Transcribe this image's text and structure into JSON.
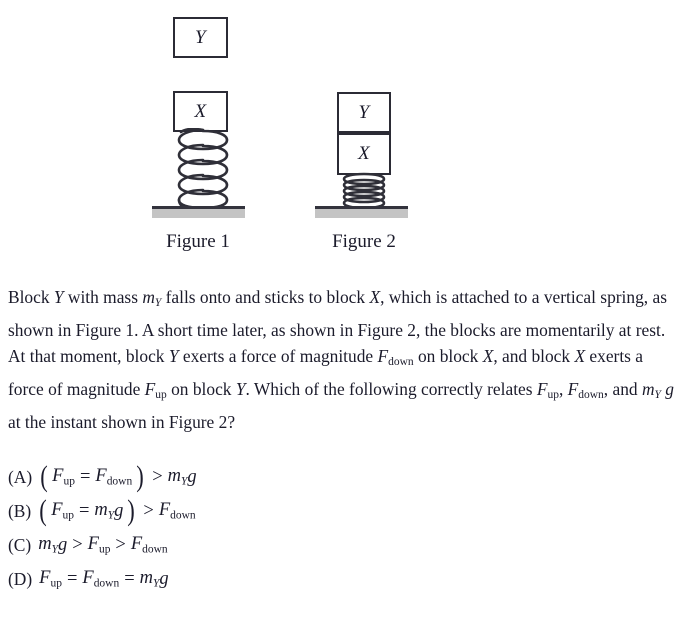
{
  "figures": [
    {
      "id": "figure-1",
      "caption": "Figure 1",
      "blocks": [
        {
          "label": "Y",
          "name": "block-y-falling"
        },
        {
          "label": "X",
          "name": "block-x-on-spring"
        }
      ],
      "spring_state": "extended",
      "spring_coils": 5
    },
    {
      "id": "figure-2",
      "caption": "Figure 2",
      "blocks": [
        {
          "label": "Y",
          "name": "block-y-stacked"
        },
        {
          "label": "X",
          "name": "block-x-stacked"
        }
      ],
      "spring_state": "compressed",
      "spring_coils": 5
    }
  ],
  "question": {
    "line1_a": "Block ",
    "line1_b": "Y",
    "line1_c": " with mass ",
    "line1_m": "m",
    "line1_sub": "Y",
    "line1_d": " falls onto and sticks to block ",
    "line1_e": "X",
    "line1_f": ", which is attached to a",
    "line2_a": "vertical spring, as shown in Figure 1. A short time later, as shown in Figure 2,",
    "line3_a": "the blocks are momentarily at rest. At that moment, block ",
    "line3_b": "Y",
    "line3_c": " exerts a force of",
    "line4_a": "magnitude ",
    "line4_F": "F",
    "line4_sub": "down",
    "line4_b": " on block ",
    "line4_c": "X",
    "line4_d": ", and block ",
    "line4_e": "X",
    "line4_f": " exerts a force of magnitude ",
    "line4_F2": "F",
    "line4_sub2": "up",
    "line4_g": " on",
    "line5_a": "block ",
    "line5_b": "Y",
    "line5_c": ". Which of the following correctly relates ",
    "line5_F1": "F",
    "line5_sub1": "up",
    "line5_comma1": ", ",
    "line5_F2": "F",
    "line5_sub2": "down",
    "line5_comma2": ", and ",
    "line5_m": "m",
    "line5_msub": "Y",
    "line5_g": " g",
    "line5_d": " at the instant",
    "line6_a": "shown in Figure 2?"
  },
  "choices": [
    {
      "tag": "(A)",
      "name": "choice-a",
      "paren": true,
      "inner": [
        {
          "sym": "F",
          "sub": "up",
          "sub_italic": false
        },
        {
          "op": "="
        },
        {
          "sym": "F",
          "sub": "down",
          "sub_italic": false
        }
      ],
      "after": [
        {
          "op": ">"
        },
        {
          "sym": "m",
          "sub": "Y",
          "sub_italic": true
        },
        {
          "sym": "g",
          "sub": ""
        }
      ]
    },
    {
      "tag": "(B)",
      "name": "choice-b",
      "paren": true,
      "inner": [
        {
          "sym": "F",
          "sub": "up",
          "sub_italic": false
        },
        {
          "op": "="
        },
        {
          "sym": "m",
          "sub": "Y",
          "sub_italic": true
        },
        {
          "sym": "g",
          "sub": ""
        }
      ],
      "after": [
        {
          "op": ">"
        },
        {
          "sym": "F",
          "sub": "down",
          "sub_italic": false
        }
      ]
    },
    {
      "tag": "(C)",
      "name": "choice-c",
      "paren": false,
      "inner": [],
      "after": [
        {
          "sym": "m",
          "sub": "Y",
          "sub_italic": true
        },
        {
          "sym": "g",
          "sub": ""
        },
        {
          "op": ">"
        },
        {
          "sym": "F",
          "sub": "up",
          "sub_italic": false
        },
        {
          "op": ">"
        },
        {
          "sym": "F",
          "sub": "down",
          "sub_italic": false
        }
      ]
    },
    {
      "tag": "(D)",
      "name": "choice-d",
      "paren": false,
      "inner": [],
      "after": [
        {
          "sym": "F",
          "sub": "up",
          "sub_italic": false
        },
        {
          "op": "="
        },
        {
          "sym": "F",
          "sub": "down",
          "sub_italic": false
        },
        {
          "op": "="
        },
        {
          "sym": "m",
          "sub": "Y",
          "sub_italic": true
        },
        {
          "sym": "g",
          "sub": ""
        }
      ]
    }
  ],
  "colors": {
    "ink": "#1b1b2b",
    "outline": "#2b2b35",
    "ground_fill": "#c4c4c4",
    "ground_edge": "#33333d",
    "spring": "#2f2f38"
  }
}
